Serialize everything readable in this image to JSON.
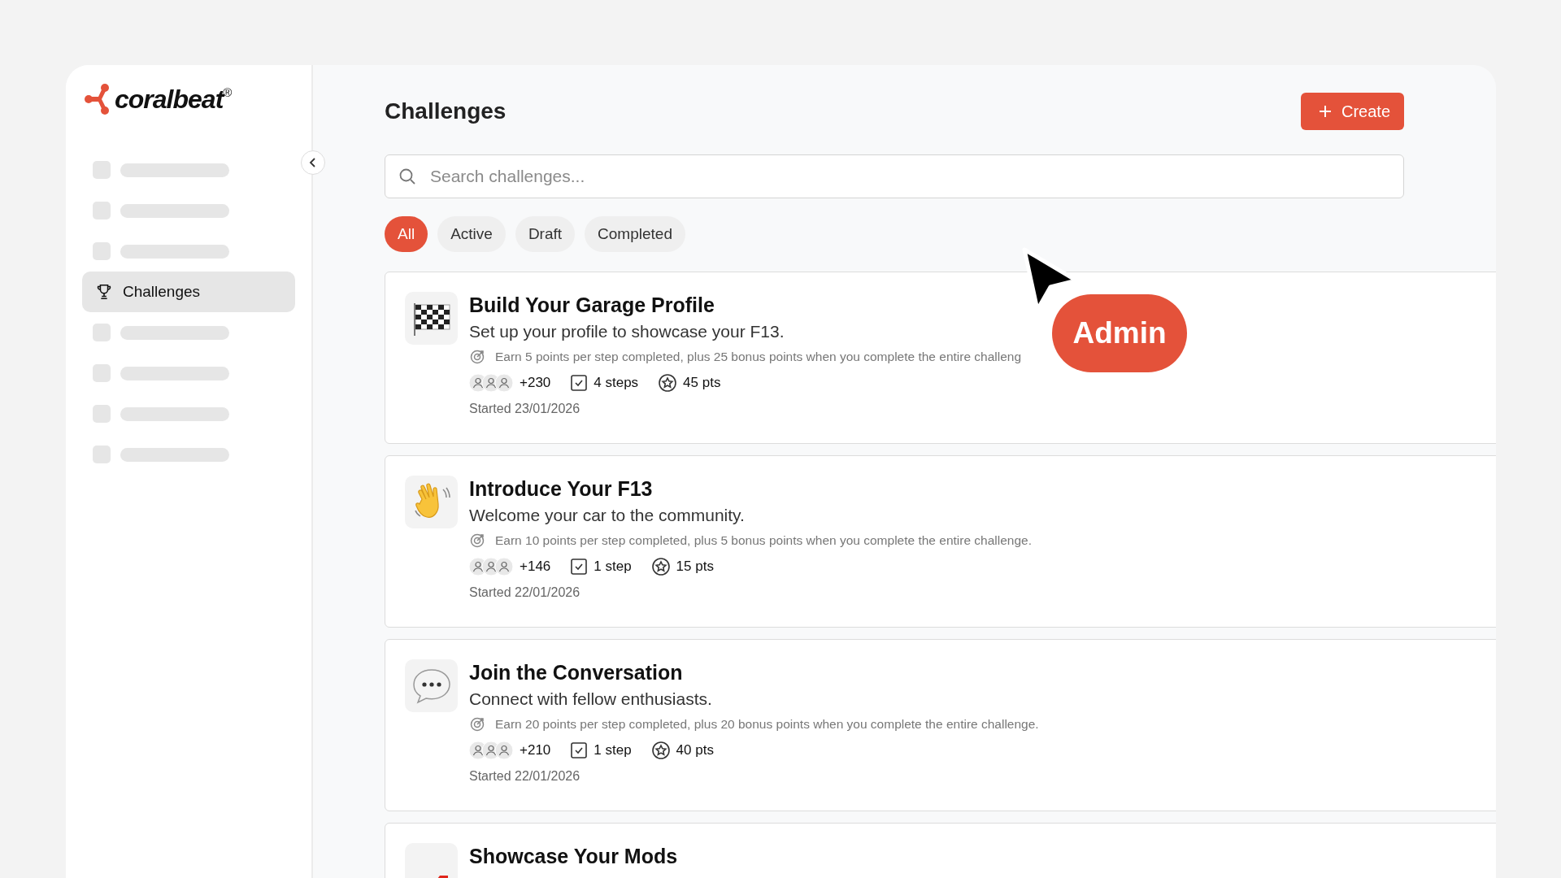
{
  "logo": {
    "text": "coralbeat$^{®}$"
  },
  "sidebar": {
    "items": [
      {
        "kind": "placeholder",
        "selected": false
      },
      {
        "kind": "placeholder",
        "selected": false
      },
      {
        "kind": "placeholder",
        "selected": false
      },
      {
        "kind": "link",
        "label": "Challenges",
        "selected": true
      },
      {
        "kind": "placeholder",
        "selected": false
      },
      {
        "kind": "placeholder",
        "selected": false
      },
      {
        "kind": "placeholder",
        "selected": false
      },
      {
        "kind": "placeholder",
        "selected": false
      }
    ]
  },
  "page": {
    "title": "Challenges",
    "create_button": "Create"
  },
  "search": {
    "placeholder": "Search challenges..."
  },
  "filters": [
    {
      "label": "All",
      "selected": true
    },
    {
      "label": "Active",
      "selected": false
    },
    {
      "label": "Draft",
      "selected": false
    },
    {
      "label": "Completed",
      "selected": false
    }
  ],
  "challenges": [
    {
      "kind": "flag",
      "title": "Build Your Garage Profile",
      "subtitle": "Set up your profile to showcase your F13.",
      "rule": "Earn 5 points per step completed, plus 25 bonus points when you complete the entire challeng",
      "participants": "+230",
      "steps": "4 steps",
      "points": "45 pts",
      "started": "Started 23/01/2026"
    },
    {
      "kind": "wave",
      "title": "Introduce Your F13",
      "subtitle": "Welcome your car to the community.",
      "rule": "Earn 10 points per step completed, plus 5 bonus points when you complete the entire challenge.",
      "participants": "+146",
      "steps": "1 step",
      "points": "15 pts",
      "started": "Started 22/01/2026"
    },
    {
      "kind": "chat",
      "title": "Join the Conversation",
      "subtitle": "Connect with fellow enthusiasts.",
      "rule": "Earn 20 points per step completed, plus 20 bonus points when you complete the entire challenge.",
      "participants": "+210",
      "steps": "1 step",
      "points": "40 pts",
      "started": "Started 22/01/2026"
    },
    {
      "kind": "car",
      "title": "Showcase Your Mods"
    }
  ],
  "overlay": {
    "badge": "Admin"
  }
}
